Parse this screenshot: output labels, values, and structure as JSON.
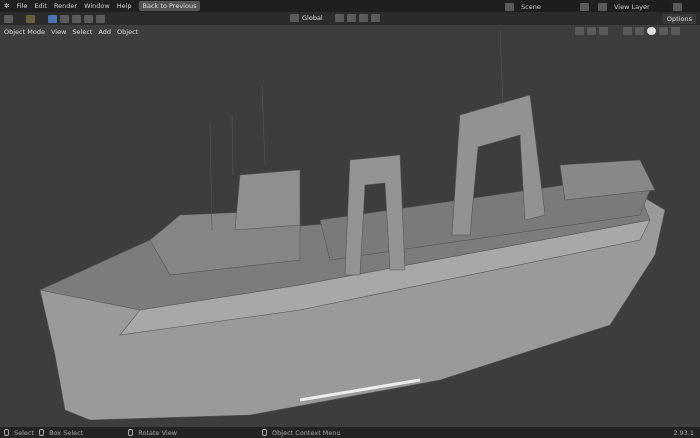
{
  "topbar": {
    "menus": [
      "File",
      "Edit",
      "Render",
      "Window",
      "Help"
    ],
    "back_button": "Back to Previous",
    "scene": "Scene",
    "view_layer": "View Layer"
  },
  "header": {
    "orientation": "Global",
    "options": "Options"
  },
  "viewport_header": {
    "mode": "Object Mode",
    "menus": [
      "View",
      "Select",
      "Add",
      "Object"
    ]
  },
  "status": {
    "items": [
      "Select",
      "Box Select",
      "Rotate View",
      "Object Context Menu"
    ],
    "version": "2.93.1"
  }
}
